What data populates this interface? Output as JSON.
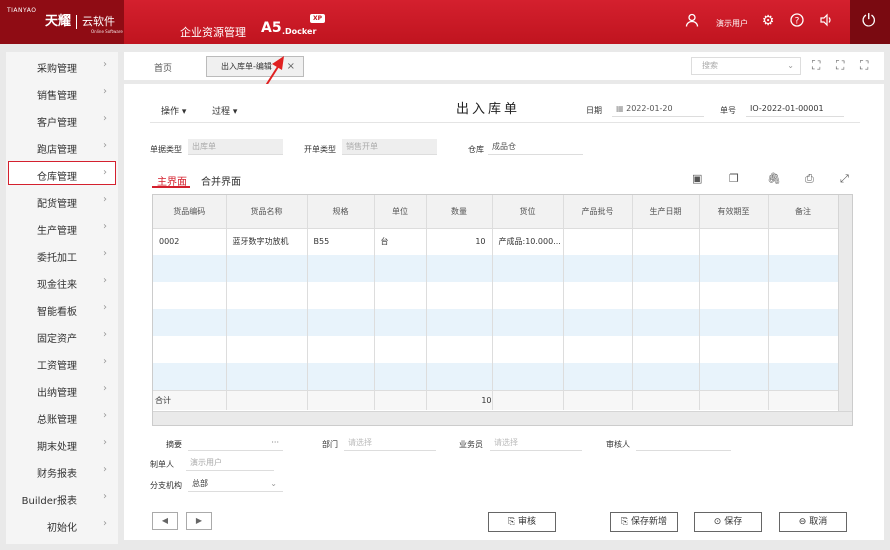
{
  "header": {
    "brand_top": "TIANYAO",
    "brand_main": "天耀",
    "brand_yun": "云软件",
    "brand_small": "Online Software",
    "system_title": "企业资源管理",
    "product_a5": "A5",
    "product_docker": ".Docker",
    "product_badge": "XP",
    "username": "演示用户",
    "icons": [
      "user-icon",
      "gear-icon",
      "help-icon",
      "speaker-icon",
      "power-icon"
    ]
  },
  "sidebar": {
    "items": [
      {
        "label": "采购管理"
      },
      {
        "label": "销售管理"
      },
      {
        "label": "客户管理"
      },
      {
        "label": "跑店管理"
      },
      {
        "label": "仓库管理",
        "active": true
      },
      {
        "label": "配货管理"
      },
      {
        "label": "生产管理"
      },
      {
        "label": "委托加工"
      },
      {
        "label": "现金往来"
      },
      {
        "label": "智能看板"
      },
      {
        "label": "固定资产"
      },
      {
        "label": "工资管理"
      },
      {
        "label": "出纳管理"
      },
      {
        "label": "总账管理"
      },
      {
        "label": "期末处理"
      },
      {
        "label": "财务报表"
      },
      {
        "label": "Builder报表"
      },
      {
        "label": "初始化"
      }
    ]
  },
  "tabs": {
    "home": "首页",
    "edit": "出入库单-编辑",
    "close": "×",
    "search_placeholder": "搜索"
  },
  "form": {
    "menu_ops": "操作 ▾",
    "menu_process": "过程 ▾",
    "title": "出入库单",
    "date_label": "日期",
    "date_value": "2022-01-20",
    "docno_label": "单号",
    "docno_value": "IO-2022-01-00001",
    "doctype_label": "单据类型",
    "doctype_value": "出库单",
    "opentype_label": "开单类型",
    "opentype_value": "销售开单",
    "warehouse_label": "仓库",
    "warehouse_value": "成品仓",
    "subtab_main": "主界面",
    "subtab_merge": "合并界面",
    "summary_label": "摘要",
    "summary_more": "···",
    "dept_label": "部门",
    "dept_placeholder": "请选择",
    "salesman_label": "业务员",
    "salesman_placeholder": "请选择",
    "auditor_label": "审核人",
    "maker_label": "制单人",
    "maker_value": "演示用户",
    "branch_label": "分支机构",
    "branch_value": "总部"
  },
  "table": {
    "headers": [
      "货品编码",
      "货品名称",
      "规格",
      "单位",
      "数量",
      "货位",
      "产品批号",
      "生产日期",
      "有效期至",
      "备注"
    ],
    "rows": [
      [
        "0002",
        "蓝牙数字功放机",
        "B55",
        "台",
        "10",
        "产成品:10.000...",
        "",
        "",
        "",
        ""
      ]
    ],
    "total_label": "合计",
    "total_qty": "10"
  },
  "buttons": {
    "audit": "审核",
    "save_new": "保存新增",
    "save": "保存",
    "cancel": "取消"
  },
  "colors": {
    "brand_red": "#c0141f",
    "accent_red": "#d4202e",
    "row_stripe": "#e8f3fb"
  }
}
